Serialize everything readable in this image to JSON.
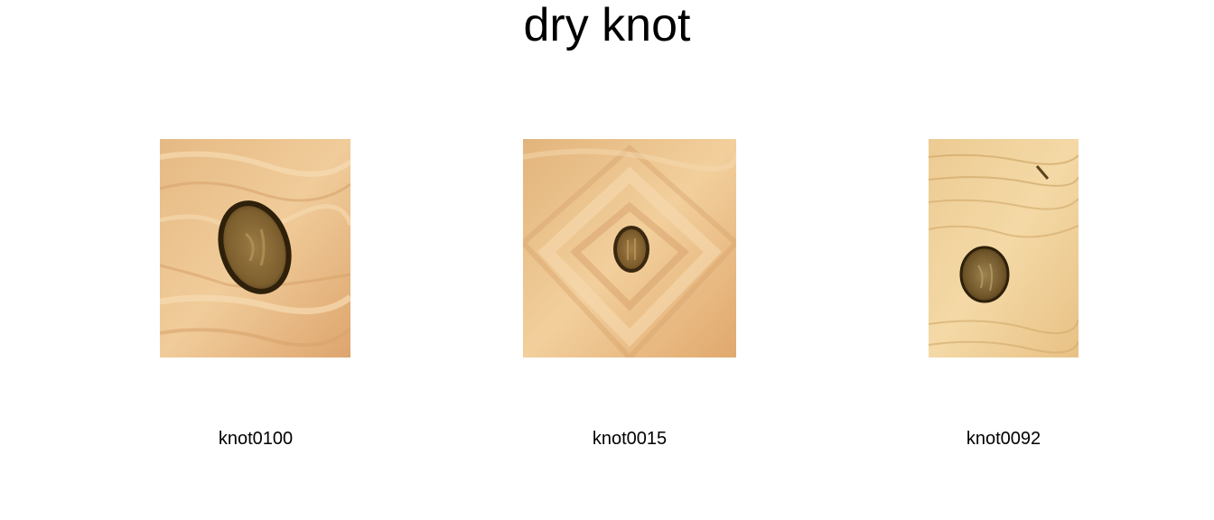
{
  "title": "dry knot",
  "samples": [
    {
      "label": "knot0100"
    },
    {
      "label": "knot0015"
    },
    {
      "label": "knot0092"
    }
  ],
  "colors": {
    "wood_light": "#f1cf9b",
    "wood_mid": "#e2b47b",
    "wood_dark": "#c98e52",
    "knot_ring": "#3a2810",
    "knot_fill": "#8a6a35"
  }
}
